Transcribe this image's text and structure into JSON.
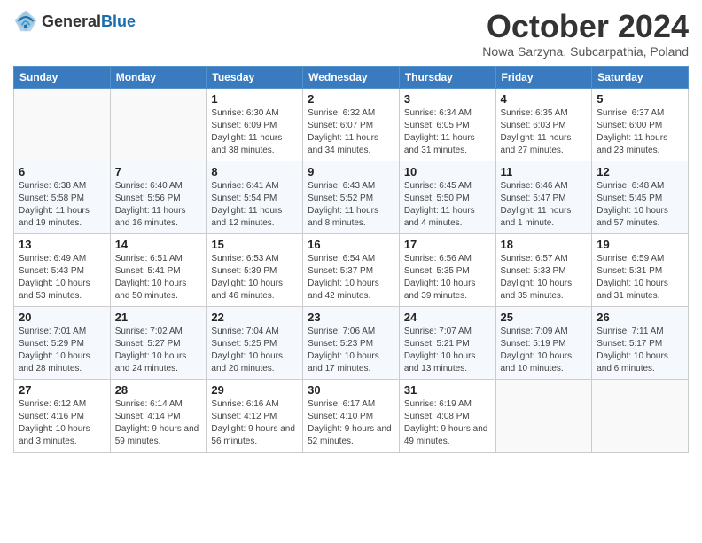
{
  "header": {
    "logo_general": "General",
    "logo_blue": "Blue",
    "month_title": "October 2024",
    "subtitle": "Nowa Sarzyna, Subcarpathia, Poland"
  },
  "weekdays": [
    "Sunday",
    "Monday",
    "Tuesday",
    "Wednesday",
    "Thursday",
    "Friday",
    "Saturday"
  ],
  "weeks": [
    [
      {
        "day": "",
        "sunrise": "",
        "sunset": "",
        "daylight": ""
      },
      {
        "day": "",
        "sunrise": "",
        "sunset": "",
        "daylight": ""
      },
      {
        "day": "1",
        "sunrise": "Sunrise: 6:30 AM",
        "sunset": "Sunset: 6:09 PM",
        "daylight": "Daylight: 11 hours and 38 minutes."
      },
      {
        "day": "2",
        "sunrise": "Sunrise: 6:32 AM",
        "sunset": "Sunset: 6:07 PM",
        "daylight": "Daylight: 11 hours and 34 minutes."
      },
      {
        "day": "3",
        "sunrise": "Sunrise: 6:34 AM",
        "sunset": "Sunset: 6:05 PM",
        "daylight": "Daylight: 11 hours and 31 minutes."
      },
      {
        "day": "4",
        "sunrise": "Sunrise: 6:35 AM",
        "sunset": "Sunset: 6:03 PM",
        "daylight": "Daylight: 11 hours and 27 minutes."
      },
      {
        "day": "5",
        "sunrise": "Sunrise: 6:37 AM",
        "sunset": "Sunset: 6:00 PM",
        "daylight": "Daylight: 11 hours and 23 minutes."
      }
    ],
    [
      {
        "day": "6",
        "sunrise": "Sunrise: 6:38 AM",
        "sunset": "Sunset: 5:58 PM",
        "daylight": "Daylight: 11 hours and 19 minutes."
      },
      {
        "day": "7",
        "sunrise": "Sunrise: 6:40 AM",
        "sunset": "Sunset: 5:56 PM",
        "daylight": "Daylight: 11 hours and 16 minutes."
      },
      {
        "day": "8",
        "sunrise": "Sunrise: 6:41 AM",
        "sunset": "Sunset: 5:54 PM",
        "daylight": "Daylight: 11 hours and 12 minutes."
      },
      {
        "day": "9",
        "sunrise": "Sunrise: 6:43 AM",
        "sunset": "Sunset: 5:52 PM",
        "daylight": "Daylight: 11 hours and 8 minutes."
      },
      {
        "day": "10",
        "sunrise": "Sunrise: 6:45 AM",
        "sunset": "Sunset: 5:50 PM",
        "daylight": "Daylight: 11 hours and 4 minutes."
      },
      {
        "day": "11",
        "sunrise": "Sunrise: 6:46 AM",
        "sunset": "Sunset: 5:47 PM",
        "daylight": "Daylight: 11 hours and 1 minute."
      },
      {
        "day": "12",
        "sunrise": "Sunrise: 6:48 AM",
        "sunset": "Sunset: 5:45 PM",
        "daylight": "Daylight: 10 hours and 57 minutes."
      }
    ],
    [
      {
        "day": "13",
        "sunrise": "Sunrise: 6:49 AM",
        "sunset": "Sunset: 5:43 PM",
        "daylight": "Daylight: 10 hours and 53 minutes."
      },
      {
        "day": "14",
        "sunrise": "Sunrise: 6:51 AM",
        "sunset": "Sunset: 5:41 PM",
        "daylight": "Daylight: 10 hours and 50 minutes."
      },
      {
        "day": "15",
        "sunrise": "Sunrise: 6:53 AM",
        "sunset": "Sunset: 5:39 PM",
        "daylight": "Daylight: 10 hours and 46 minutes."
      },
      {
        "day": "16",
        "sunrise": "Sunrise: 6:54 AM",
        "sunset": "Sunset: 5:37 PM",
        "daylight": "Daylight: 10 hours and 42 minutes."
      },
      {
        "day": "17",
        "sunrise": "Sunrise: 6:56 AM",
        "sunset": "Sunset: 5:35 PM",
        "daylight": "Daylight: 10 hours and 39 minutes."
      },
      {
        "day": "18",
        "sunrise": "Sunrise: 6:57 AM",
        "sunset": "Sunset: 5:33 PM",
        "daylight": "Daylight: 10 hours and 35 minutes."
      },
      {
        "day": "19",
        "sunrise": "Sunrise: 6:59 AM",
        "sunset": "Sunset: 5:31 PM",
        "daylight": "Daylight: 10 hours and 31 minutes."
      }
    ],
    [
      {
        "day": "20",
        "sunrise": "Sunrise: 7:01 AM",
        "sunset": "Sunset: 5:29 PM",
        "daylight": "Daylight: 10 hours and 28 minutes."
      },
      {
        "day": "21",
        "sunrise": "Sunrise: 7:02 AM",
        "sunset": "Sunset: 5:27 PM",
        "daylight": "Daylight: 10 hours and 24 minutes."
      },
      {
        "day": "22",
        "sunrise": "Sunrise: 7:04 AM",
        "sunset": "Sunset: 5:25 PM",
        "daylight": "Daylight: 10 hours and 20 minutes."
      },
      {
        "day": "23",
        "sunrise": "Sunrise: 7:06 AM",
        "sunset": "Sunset: 5:23 PM",
        "daylight": "Daylight: 10 hours and 17 minutes."
      },
      {
        "day": "24",
        "sunrise": "Sunrise: 7:07 AM",
        "sunset": "Sunset: 5:21 PM",
        "daylight": "Daylight: 10 hours and 13 minutes."
      },
      {
        "day": "25",
        "sunrise": "Sunrise: 7:09 AM",
        "sunset": "Sunset: 5:19 PM",
        "daylight": "Daylight: 10 hours and 10 minutes."
      },
      {
        "day": "26",
        "sunrise": "Sunrise: 7:11 AM",
        "sunset": "Sunset: 5:17 PM",
        "daylight": "Daylight: 10 hours and 6 minutes."
      }
    ],
    [
      {
        "day": "27",
        "sunrise": "Sunrise: 6:12 AM",
        "sunset": "Sunset: 4:16 PM",
        "daylight": "Daylight: 10 hours and 3 minutes."
      },
      {
        "day": "28",
        "sunrise": "Sunrise: 6:14 AM",
        "sunset": "Sunset: 4:14 PM",
        "daylight": "Daylight: 9 hours and 59 minutes."
      },
      {
        "day": "29",
        "sunrise": "Sunrise: 6:16 AM",
        "sunset": "Sunset: 4:12 PM",
        "daylight": "Daylight: 9 hours and 56 minutes."
      },
      {
        "day": "30",
        "sunrise": "Sunrise: 6:17 AM",
        "sunset": "Sunset: 4:10 PM",
        "daylight": "Daylight: 9 hours and 52 minutes."
      },
      {
        "day": "31",
        "sunrise": "Sunrise: 6:19 AM",
        "sunset": "Sunset: 4:08 PM",
        "daylight": "Daylight: 9 hours and 49 minutes."
      },
      {
        "day": "",
        "sunrise": "",
        "sunset": "",
        "daylight": ""
      },
      {
        "day": "",
        "sunrise": "",
        "sunset": "",
        "daylight": ""
      }
    ]
  ]
}
